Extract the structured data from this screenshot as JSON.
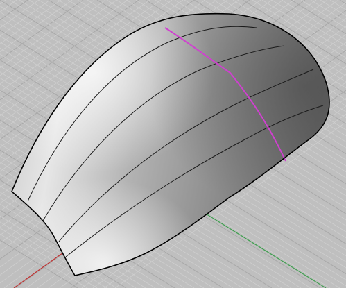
{
  "viewport": {
    "background": "#bfbfbf",
    "grid_minor_color": "#cfcfcf",
    "grid_major_color": "#a8a8a8",
    "x_axis_color": "#c03030",
    "y_axis_color": "#3f9f4f"
  },
  "surface": {
    "edge_color": "#000000",
    "isocurve_color": "#1a1a1a",
    "highlight_curve_color": "#d040d0",
    "shade_light": "#f2f2f2",
    "shade_mid": "#a5a5a5",
    "shade_dark": "#5e5e5e"
  }
}
